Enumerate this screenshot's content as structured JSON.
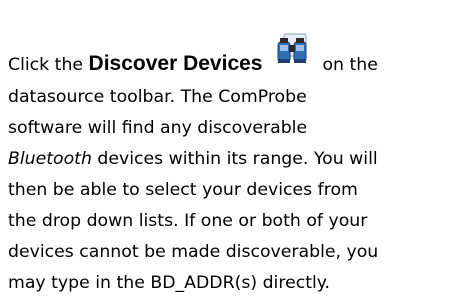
{
  "paragraph": {
    "prefix": "Click the ",
    "button_name": "Discover Devices",
    "after_icon": " on the",
    "line2": "datasource toolbar. The ComProbe",
    "line3": "software will find any discoverable",
    "line4_italic": "Bluetooth",
    "line4_rest": " devices within its range. You will",
    "line5": "then be able to select your devices from",
    "line6": "the drop down lists. If one or both of your",
    "line7": "devices cannot be made discoverable, you",
    "line8": "may type in the BD_ADDR(s) directly."
  },
  "icons": {
    "discover": "binoculars-icon"
  },
  "colors": {
    "text": "#000000",
    "icon_blue": "#2f6db5",
    "icon_dark": "#2b2b2b"
  }
}
